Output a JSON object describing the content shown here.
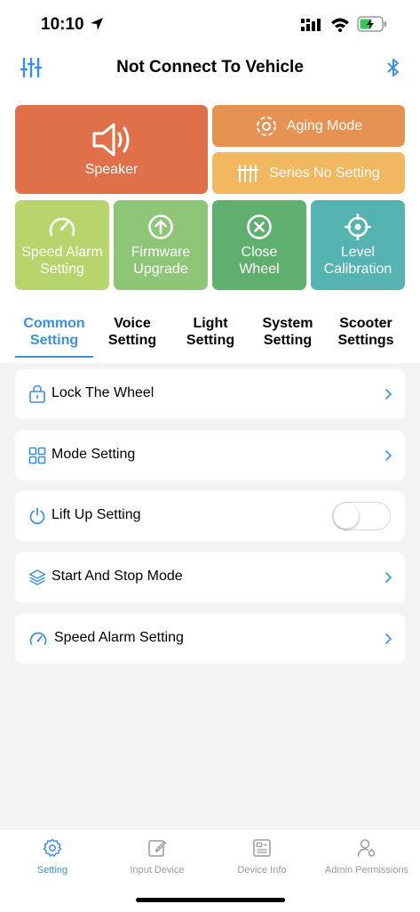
{
  "status_bar": {
    "time": "10:10"
  },
  "header": {
    "title": "Not Connect To Vehicle",
    "left_icon": "sliders-icon",
    "right_icon": "bluetooth-icon"
  },
  "tiles": {
    "speaker": {
      "label": "Speaker",
      "color": "#e0704a"
    },
    "aging_mode": {
      "label": "Aging Mode",
      "color": "#e69252"
    },
    "series_no": {
      "label": "Series No Setting",
      "color": "#f1b860"
    },
    "speed_alarm": {
      "label_line1": "Speed Alarm",
      "label_line2": "Setting",
      "color": "#b7d56c"
    },
    "firmware": {
      "label_line1": "Firmware",
      "label_line2": "Upgrade",
      "color": "#8fc576"
    },
    "close_wheel": {
      "label_line1": "Close",
      "label_line2": "Wheel",
      "color": "#5fb06f"
    },
    "level_calibration": {
      "label_line1": "Level",
      "label_line2": "Calibration",
      "color": "#55b3b1"
    }
  },
  "tabs": [
    {
      "line1": "Common",
      "line2": "Setting",
      "active": true
    },
    {
      "line1": "Voice",
      "line2": "Setting",
      "active": false
    },
    {
      "line1": "Light",
      "line2": "Setting",
      "active": false
    },
    {
      "line1": "System",
      "line2": "Setting",
      "active": false
    },
    {
      "line1": "Scooter",
      "line2": "Settings",
      "active": false
    }
  ],
  "settings": [
    {
      "label": "Lock The Wheel",
      "icon": "lock-icon",
      "control": "chevron"
    },
    {
      "label": "Mode Setting",
      "icon": "grid-icon",
      "control": "chevron"
    },
    {
      "label": "Lift Up Setting",
      "icon": "power-icon",
      "control": "toggle",
      "toggle_on": false
    },
    {
      "label": "Start And Stop Mode",
      "icon": "layers-icon",
      "control": "chevron"
    },
    {
      "label": "Speed Alarm Setting",
      "icon": "speedometer-icon",
      "control": "chevron"
    }
  ],
  "bottom_nav": [
    {
      "label": "Setting",
      "icon": "gear-icon",
      "active": true
    },
    {
      "label": "Input Device",
      "icon": "edit-icon",
      "active": false
    },
    {
      "label": "Device Info",
      "icon": "device-info-icon",
      "active": false
    },
    {
      "label": "Admin Permissions",
      "icon": "user-settings-icon",
      "active": false
    }
  ],
  "colors": {
    "accent": "#3a8fe0",
    "list_background": "#f3f3f5"
  }
}
